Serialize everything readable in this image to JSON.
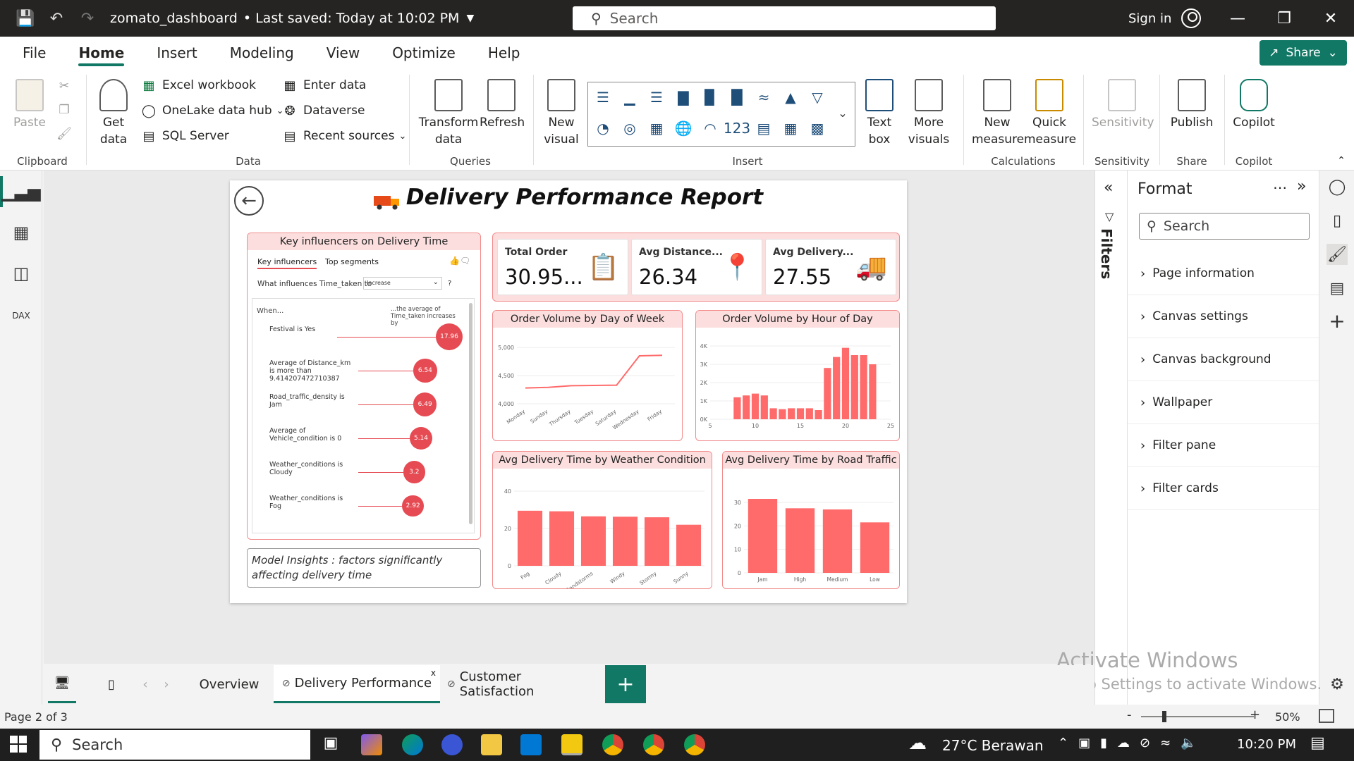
{
  "titlebar": {
    "doc_title": "zomato_dashboard",
    "saved": "• Last saved: Today at 10:02 PM",
    "search_placeholder": "Search",
    "signin": "Sign in"
  },
  "menu": {
    "items": [
      "File",
      "Home",
      "Insert",
      "Modeling",
      "View",
      "Optimize",
      "Help"
    ],
    "share": "Share"
  },
  "ribbon": {
    "paste": "Paste",
    "get_data": "Get data",
    "excel": "Excel workbook",
    "onelake": "OneLake data hub",
    "sql": "SQL Server",
    "enter_data": "Enter data",
    "dataverse": "Dataverse",
    "recent": "Recent sources",
    "transform": "Transform data",
    "refresh": "Refresh",
    "new_visual": "New visual",
    "text_box": "Text box",
    "more_visuals": "More visuals",
    "new_measure": "New measure",
    "quick_measure": "Quick measure",
    "sensitivity": "Sensitivity",
    "publish": "Publish",
    "copilot": "Copilot",
    "groups": {
      "clipboard": "Clipboard",
      "data": "Data",
      "queries": "Queries",
      "insert": "Insert",
      "calculations": "Calculations",
      "sensitivity": "Sensitivity",
      "share": "Share",
      "copilot": "Copilot"
    }
  },
  "report": {
    "title": "Delivery Performance Report",
    "key_influencers": {
      "title": "Key influencers on Delivery Time",
      "tab1": "Key influencers",
      "tab2": "Top segments",
      "question": "What influences Time_taken to",
      "dropdown": "Increase",
      "qmark": "?",
      "when": "When...",
      "avg_header": "...the average of Time_taken increases by",
      "rows": [
        {
          "label": "Festival is Yes",
          "value": "17.96",
          "v": 17.96
        },
        {
          "label": "Average of Distance_km is more than 9.414207472710387",
          "value": "6.54",
          "v": 6.54
        },
        {
          "label": "Road_traffic_density is Jam",
          "value": "6.49",
          "v": 6.49
        },
        {
          "label": "Average of Vehicle_condition is 0",
          "value": "5.14",
          "v": 5.14
        },
        {
          "label": "Weather_conditions is Cloudy",
          "value": "3.2",
          "v": 3.2
        },
        {
          "label": "Weather_conditions is Fog",
          "value": "2.92",
          "v": 2.92
        }
      ]
    },
    "insight": "Model Insights : factors significantly affecting delivery time",
    "kpis": [
      {
        "label": "Total Order",
        "value": "30.95...",
        "icon": "clipboard-icon"
      },
      {
        "label": "Avg Distance...",
        "value": "26.34",
        "icon": "location-pin-icon"
      },
      {
        "label": "Avg Delivery...",
        "value": "27.55",
        "icon": "delivery-truck-icon"
      }
    ],
    "accent": "#ff6b6b"
  },
  "chart_data": [
    {
      "type": "line",
      "title": "Order Volume by Day of Week",
      "categories": [
        "Monday",
        "Sunday",
        "Thursday",
        "Tuesday",
        "Saturday",
        "Wednesday",
        "Friday"
      ],
      "values": [
        4280,
        4290,
        4320,
        4325,
        4330,
        4850,
        4860
      ],
      "ylim": [
        4000,
        5000
      ],
      "yticks": [
        "4,000",
        "4,500",
        "5,000"
      ]
    },
    {
      "type": "bar",
      "title": "Order Volume by Hour of Day",
      "x": [
        8,
        9,
        10,
        11,
        12,
        13,
        14,
        15,
        16,
        17,
        18,
        19,
        20,
        21,
        22,
        23
      ],
      "values": [
        1200,
        1300,
        1400,
        1300,
        600,
        550,
        600,
        600,
        600,
        500,
        2800,
        3400,
        3900,
        3500,
        3500,
        3000
      ],
      "ylim": [
        0,
        4000
      ],
      "yticks": [
        "0K",
        "1K",
        "2K",
        "3K",
        "4K"
      ],
      "xticks": [
        "5",
        "10",
        "15",
        "20",
        "25"
      ],
      "xlim": [
        5,
        25
      ]
    },
    {
      "type": "bar",
      "title": "Avg Delivery Time by Weather Condition",
      "categories": [
        "Fog",
        "Cloudy",
        "Sandstorms",
        "Windy",
        "Stormy",
        "Sunny"
      ],
      "values": [
        29.5,
        29.2,
        26.5,
        26.3,
        26.0,
        22.0
      ],
      "ylim": [
        0,
        40
      ],
      "yticks": [
        "0",
        "20",
        "40"
      ]
    },
    {
      "type": "bar",
      "title": "Avg Delivery Time by Road Traffic",
      "categories": [
        "Jam",
        "High",
        "Medium",
        "Low"
      ],
      "values": [
        31.5,
        27.5,
        27.0,
        21.5
      ],
      "ylim": [
        0,
        30
      ],
      "yticks": [
        "0",
        "10",
        "20",
        "30"
      ]
    }
  ],
  "format_pane": {
    "title": "Format",
    "search_placeholder": "Search",
    "items": [
      "Page information",
      "Canvas settings",
      "Canvas background",
      "Wallpaper",
      "Filter pane",
      "Filter cards"
    ]
  },
  "filters_label": "Filters",
  "tabs": [
    "Overview",
    "Delivery Performance",
    "Customer Satisfaction"
  ],
  "status": {
    "page": "Page 2 of 3",
    "zoom": "50%"
  },
  "watermark": {
    "l1": "Activate Windows",
    "l2": "Go to Settings to activate Windows."
  },
  "taskbar": {
    "search": "Search",
    "weather": "27°C Berawan",
    "time": "10:20 PM"
  }
}
